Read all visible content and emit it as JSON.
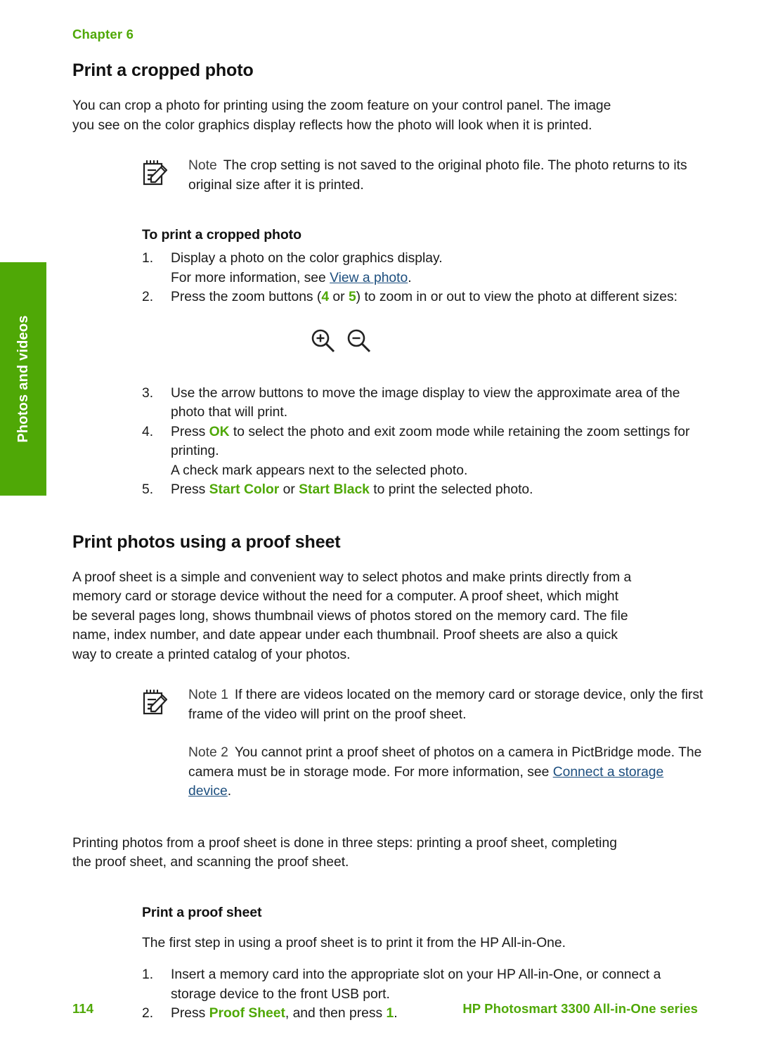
{
  "chapter": {
    "label": "Chapter 6"
  },
  "side_tab": {
    "label": "Photos and videos"
  },
  "colors": {
    "brand_green": "#4FA806",
    "link_blue": "#1C4E7E",
    "note_label": "#3C3C3C",
    "body_text": "#1A1A1A"
  },
  "sections": {
    "cropped_photo": {
      "title": "Print a cropped photo",
      "intro": "You can crop a photo for printing using the zoom feature on your control panel. The image you see on the color graphics display reflects how the photo will look when it is printed.",
      "note": {
        "icon": "note-pencil-icon",
        "label": "Note",
        "text": "The crop setting is not saved to the original photo file. The photo returns to its original size after it is printed."
      },
      "procedure_heading": "To print a cropped photo",
      "steps": [
        {
          "marker": "1.",
          "text": "Display a photo on the color graphics display.",
          "sub": "For more information, see ",
          "sub_link": "View a photo",
          "sub_tail": "."
        },
        {
          "marker": "2.",
          "pre": "Press the zoom buttons (",
          "key_a": "4",
          "mid": " or ",
          "key_b": "5",
          "post": ") to zoom in or out to view the photo at different sizes:"
        },
        {
          "marker": "3.",
          "text": "Use the arrow buttons to move the image display to view the approximate area of the photo that will print."
        },
        {
          "marker": "4.",
          "pre": "Press ",
          "key_a": "OK",
          "post": " to select the photo and exit zoom mode while retaining the zoom settings for printing.",
          "sub": "A check mark appears next to the selected photo."
        },
        {
          "marker": "5.",
          "pre": "Press ",
          "key_a": "Start Color",
          "mid": " or ",
          "key_b": "Start Black",
          "post": " to print the selected photo."
        }
      ],
      "zoom_icons": [
        {
          "name": "zoom-in-icon",
          "glyph": "+"
        },
        {
          "name": "zoom-out-icon",
          "glyph": "−"
        }
      ]
    },
    "proof_sheet": {
      "title": "Print photos using a proof sheet",
      "intro": "A proof sheet is a simple and convenient way to select photos and make prints directly from a memory card or storage device without the need for a computer. A proof sheet, which might be several pages long, shows thumbnail views of photos stored on the memory card. The file name, index number, and date appear under each thumbnail. Proof sheets are also a quick way to create a printed catalog of your photos.",
      "note1": {
        "icon": "note-pencil-icon",
        "label": "Note 1",
        "text": "If there are videos located on the memory card or storage device, only the first frame of the video will print on the proof sheet."
      },
      "note2": {
        "label": "Note 2",
        "text": "You cannot print a proof sheet of photos on a camera in PictBridge mode. The camera must be in storage mode. For more information, see ",
        "link": "Connect a storage device",
        "tail": "."
      },
      "steps_overview": "Printing photos from a proof sheet is done in three steps: printing a proof sheet, completing the proof sheet, and scanning the proof sheet.",
      "sub_heading": "Print a proof sheet",
      "sub_intro": "The first step in using a proof sheet is to print it from the HP All-in-One.",
      "steps": [
        {
          "marker": "1.",
          "text": "Insert a memory card into the appropriate slot on your HP All-in-One, or connect a storage device to the front USB port."
        },
        {
          "marker": "2.",
          "pre": "Press ",
          "key_a": "Proof Sheet",
          "mid": ", and then press ",
          "key_b": "1",
          "post": "."
        }
      ]
    }
  },
  "footer": {
    "page_number": "114",
    "product": "HP Photosmart 3300 All-in-One series"
  }
}
